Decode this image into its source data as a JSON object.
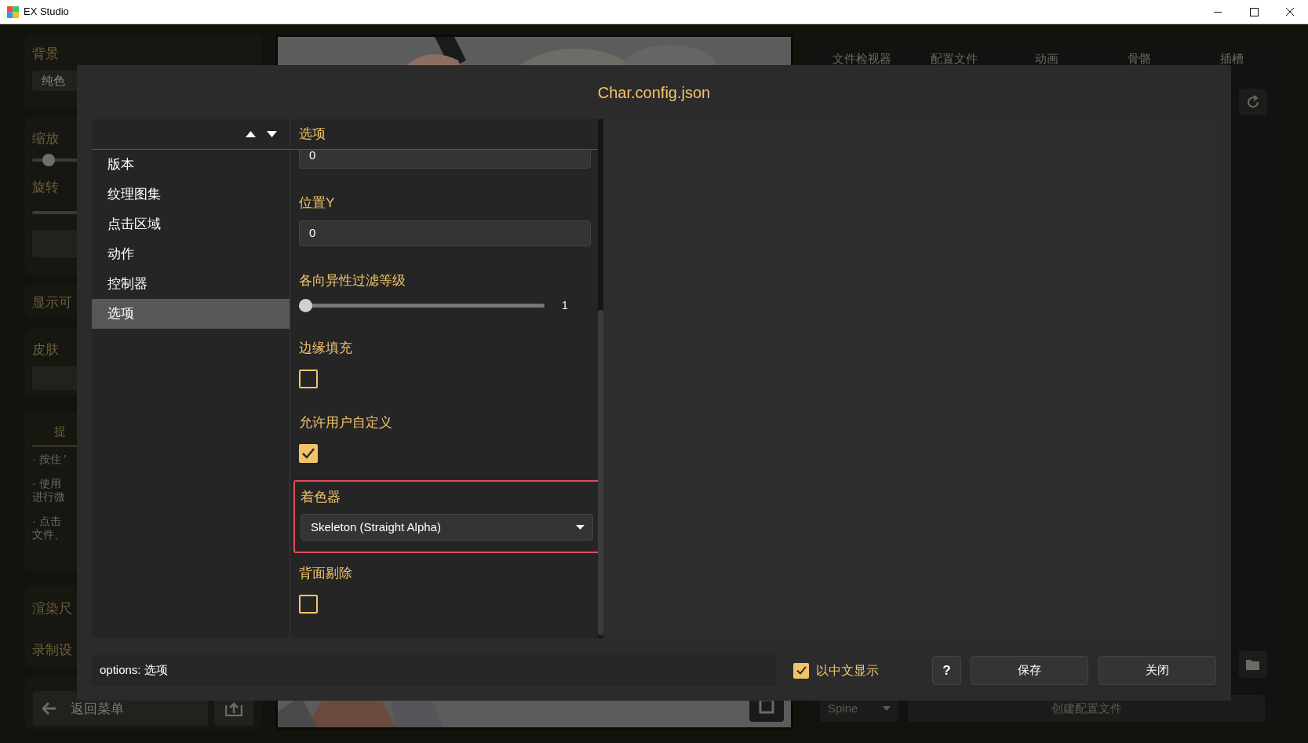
{
  "window": {
    "title": "EX Studio"
  },
  "background": {
    "bg_section": {
      "label": "背景",
      "value": "纯色"
    },
    "scale_section": {
      "label": "缩放",
      "level": 0.05
    },
    "rotation_label": "旋转",
    "display_label": "显示可",
    "skin_label": "皮肤",
    "hints": {
      "title": "提",
      "lines": [
        "· 按住 '",
        "· 使用",
        "进行微",
        "· 点击",
        "文件、"
      ]
    },
    "render_label": "渲染尺",
    "record_label": "录制设",
    "back_button": "返回菜单",
    "tabs": [
      "文件检视器",
      "配置文件",
      "动画",
      "骨骼",
      "插槽"
    ],
    "engine_select": "Spine",
    "create_button": "创建配置文件"
  },
  "dialog": {
    "title": "Char.config.json",
    "nav_items": [
      {
        "label": "版本",
        "selected": false
      },
      {
        "label": "纹理图集",
        "selected": false
      },
      {
        "label": "点击区域",
        "selected": false
      },
      {
        "label": "动作",
        "selected": false
      },
      {
        "label": "控制器",
        "selected": false
      },
      {
        "label": "选项",
        "selected": true
      }
    ],
    "section_title": "选项",
    "fields": [
      {
        "kind": "input",
        "value": "0"
      },
      {
        "kind": "input",
        "label": "位置Y",
        "value": "0"
      },
      {
        "kind": "slider",
        "label": "各向异性过滤等级",
        "level": 0,
        "reading": "1"
      },
      {
        "kind": "checkbox",
        "label": "边缘填充",
        "checked": false
      },
      {
        "kind": "checkbox",
        "label": "允许用户自定义",
        "checked": true
      },
      {
        "kind": "select",
        "label": "着色器",
        "value": "Skeleton (Straight Alpha)",
        "highlighted": true
      },
      {
        "kind": "checkbox",
        "label": "背面剔除",
        "checked": false
      }
    ],
    "status_text": "options: 选项",
    "chinese_display": {
      "label": "以中文显示",
      "checked": true
    },
    "help_button": "?",
    "save_button": "保存",
    "close_button": "关闭"
  }
}
